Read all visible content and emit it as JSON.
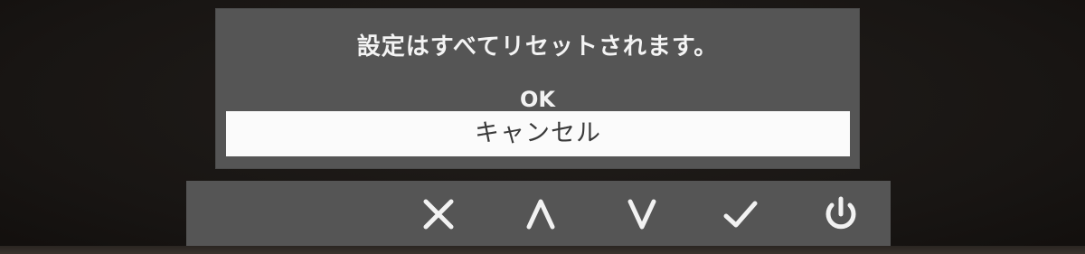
{
  "dialog": {
    "message": "設定はすべてリセットされます。",
    "options": [
      {
        "label": "OK",
        "selected": false
      },
      {
        "label": "キャンセル",
        "selected": true
      }
    ]
  },
  "buttons": [
    {
      "icon": "close-icon"
    },
    {
      "icon": "chevron-up-icon"
    },
    {
      "icon": "chevron-down-icon"
    },
    {
      "icon": "checkmark-icon"
    },
    {
      "icon": "power-icon"
    }
  ],
  "colors": {
    "panel": "#555555",
    "text": "#f4f4f4",
    "selected_bg": "#fbfbfb",
    "selected_text": "#3a3a3a",
    "background": "#1a1715"
  }
}
